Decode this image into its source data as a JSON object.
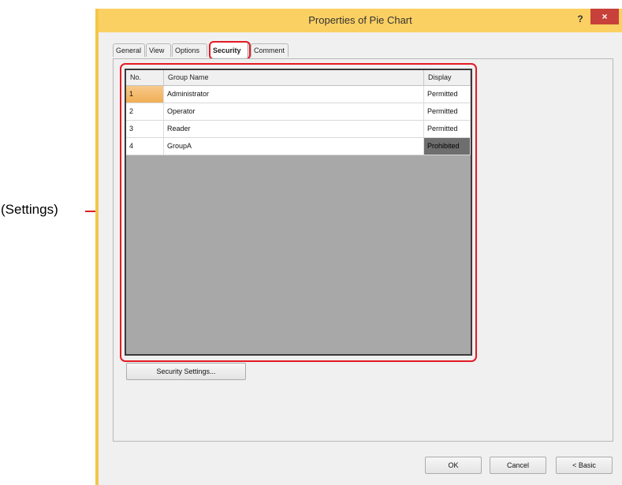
{
  "callout": {
    "label": "(Settings)"
  },
  "window": {
    "title": "Properties of Pie Chart",
    "help_label": "?",
    "close_label": "×"
  },
  "tabs": [
    {
      "label": "General"
    },
    {
      "label": "View"
    },
    {
      "label": "Options"
    },
    {
      "label": "Security",
      "active": true
    },
    {
      "label": "Comment"
    }
  ],
  "table": {
    "columns": [
      "No.",
      "Group Name",
      "Display"
    ],
    "rows": [
      {
        "no": "1",
        "group": "Administrator",
        "display": "Permitted"
      },
      {
        "no": "2",
        "group": "Operator",
        "display": "Permitted"
      },
      {
        "no": "3",
        "group": "Reader",
        "display": "Permitted"
      },
      {
        "no": "4",
        "group": "GroupA",
        "display": "Prohibited"
      }
    ]
  },
  "buttons": {
    "security_settings": "Security Settings...",
    "ok": "OK",
    "cancel": "Cancel",
    "basic": "< Basic"
  },
  "colors": {
    "titlebar": "#fbd063",
    "highlight": "#e21b24",
    "selected_cell": "#f1ae55",
    "prohibited_cell": "#6e6e6e"
  }
}
